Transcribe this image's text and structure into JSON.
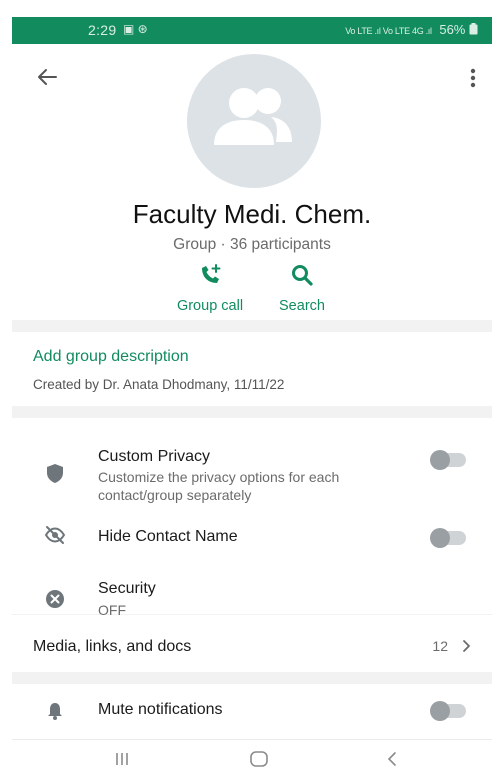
{
  "status_bar": {
    "time": "2:29",
    "notif_icons": "▣ ⊛",
    "network_text": "Vo LTE .ıl Vo LTE 4G .ıl",
    "battery": "56%"
  },
  "header": {
    "group_name": "Faculty Medi. Chem.",
    "group_info": "Group · 36 participants",
    "actions": [
      {
        "label": "Group call",
        "icon": "add-call-icon"
      },
      {
        "label": "Search",
        "icon": "search-icon"
      }
    ]
  },
  "description": {
    "add_label": "Add group description",
    "created_text": "Created by Dr. Anata Dhodmany, 11/11/22"
  },
  "settings": [
    {
      "title": "Custom Privacy",
      "subtitle": "Customize the privacy options for each contact/group separately",
      "icon": "shield-icon",
      "toggle": false
    },
    {
      "title": "Hide Contact Name",
      "icon": "eye-off-icon",
      "toggle": false
    },
    {
      "title": "Security",
      "subtitle": "OFF",
      "icon": "close-circle-icon"
    }
  ],
  "media": {
    "label": "Media, links, and docs",
    "count": "12"
  },
  "mute": {
    "label": "Mute notifications",
    "icon": "bell-icon",
    "toggle": false
  },
  "colors": {
    "accent": "#128c5e",
    "status_bar": "#128c5e",
    "avatar_bg": "#dce2e6"
  }
}
